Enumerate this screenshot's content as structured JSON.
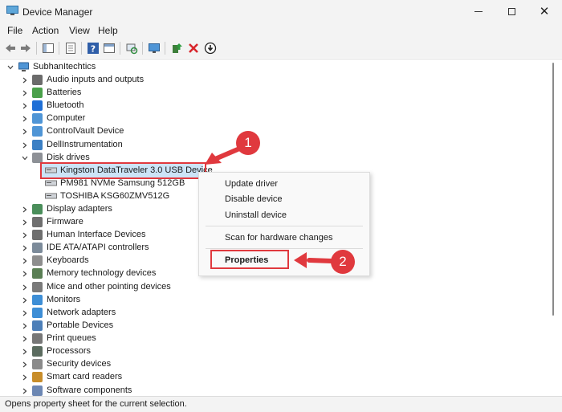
{
  "window": {
    "title": "Device Manager"
  },
  "menu": [
    "File",
    "Action",
    "View",
    "Help"
  ],
  "tree": {
    "root": "SubhanItechtics",
    "categories": [
      {
        "label": "Audio inputs and outputs",
        "icon": "speaker-icon"
      },
      {
        "label": "Batteries",
        "icon": "battery-icon"
      },
      {
        "label": "Bluetooth",
        "icon": "bluetooth-icon"
      },
      {
        "label": "Computer",
        "icon": "computer-icon"
      },
      {
        "label": "ControlVault Device",
        "icon": "controlvault-icon"
      },
      {
        "label": "DellInstrumentation",
        "icon": "dell-icon"
      },
      {
        "label": "Disk drives",
        "icon": "disk-drive-icon",
        "expanded": true
      },
      {
        "label": "Display adapters",
        "icon": "display-adapter-icon"
      },
      {
        "label": "Firmware",
        "icon": "firmware-icon"
      },
      {
        "label": "Human Interface Devices",
        "icon": "hid-icon"
      },
      {
        "label": "IDE ATA/ATAPI controllers",
        "icon": "ide-icon"
      },
      {
        "label": "Keyboards",
        "icon": "keyboard-icon"
      },
      {
        "label": "Memory technology devices",
        "icon": "memory-icon"
      },
      {
        "label": "Mice and other pointing devices",
        "icon": "mouse-icon"
      },
      {
        "label": "Monitors",
        "icon": "monitor-icon"
      },
      {
        "label": "Network adapters",
        "icon": "network-icon"
      },
      {
        "label": "Portable Devices",
        "icon": "portable-device-icon"
      },
      {
        "label": "Print queues",
        "icon": "printer-icon"
      },
      {
        "label": "Processors",
        "icon": "processor-icon"
      },
      {
        "label": "Security devices",
        "icon": "security-icon"
      },
      {
        "label": "Smart card readers",
        "icon": "smart-card-icon"
      },
      {
        "label": "Software components",
        "icon": "software-icon"
      }
    ],
    "disk_drives": [
      "Kingston DataTraveler 3.0 USB Device",
      "PM981 NVMe Samsung 512GB",
      "TOSHIBA KSG60ZMV512G"
    ]
  },
  "context_menu": {
    "items": [
      "Update driver",
      "Disable device",
      "Uninstall device",
      "Scan for hardware changes",
      "Properties"
    ]
  },
  "callouts": [
    "1",
    "2"
  ],
  "status": "Opens property sheet for the current selection.",
  "colors": {
    "selection": "#cce4f7",
    "callout_red": "#e0393e"
  }
}
